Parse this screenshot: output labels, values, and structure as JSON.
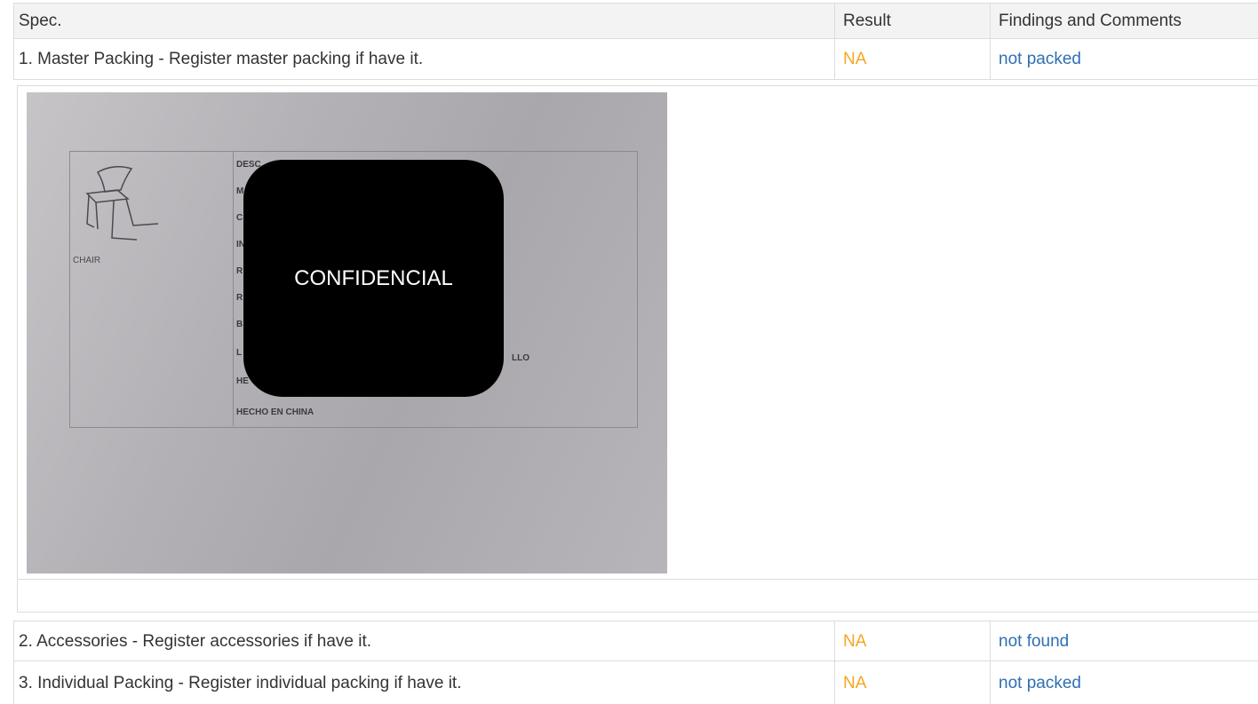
{
  "table": {
    "headers": {
      "spec": "Spec.",
      "result": "Result",
      "comments": "Findings and Comments"
    },
    "rows": [
      {
        "spec": "1. Master Packing - Register master packing if have it.",
        "result": "NA",
        "comment": "not packed"
      },
      {
        "spec": "2. Accessories - Register accessories if have it.",
        "result": "NA",
        "comment": "not found"
      },
      {
        "spec": "3. Individual Packing - Register individual packing if have it.",
        "result": "NA",
        "comment": "not packed"
      }
    ]
  },
  "photo": {
    "chair_caption": "CHAIR",
    "label_lines": [
      "DESC",
      "M",
      "C",
      "IN",
      "R",
      "R",
      "B",
      "L",
      "HE",
      "HECHO EN CHINA"
    ],
    "label_tail": "LLO",
    "redaction": "CONFIDENCIAL"
  },
  "colors": {
    "result_na": "#f5a623",
    "comment_link": "#2f6fb3",
    "header_bg": "#f3f3f3"
  }
}
